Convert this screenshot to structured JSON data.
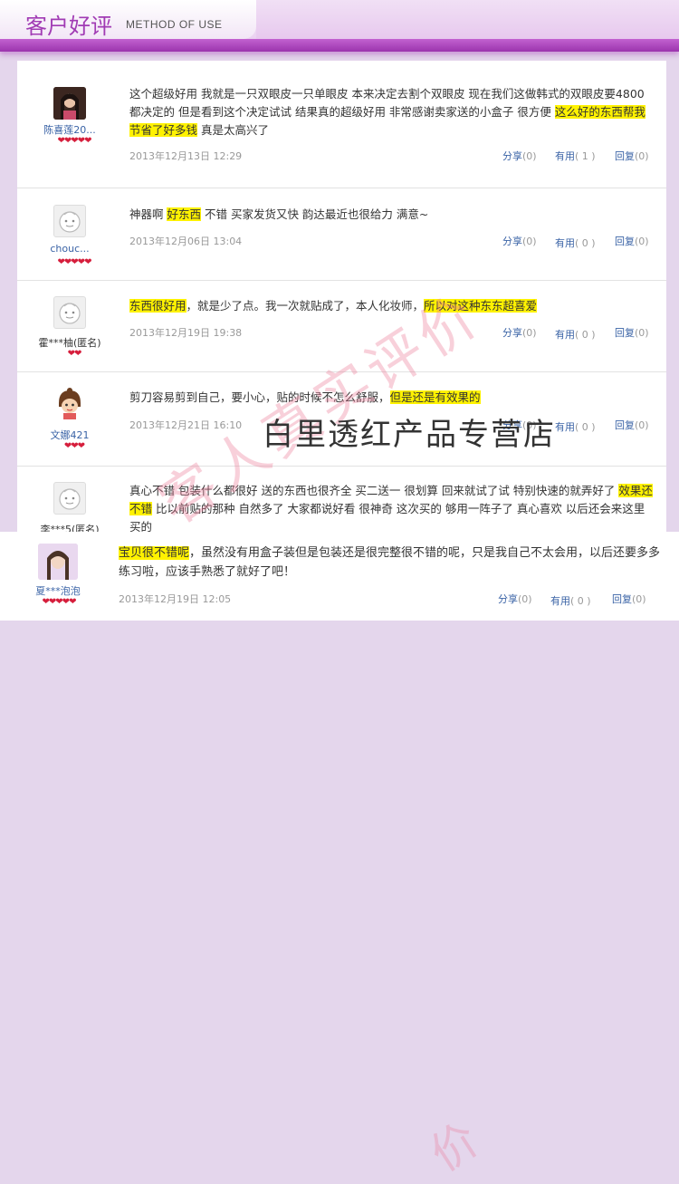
{
  "header": {
    "title": "客户好评",
    "subtitle": "METHOD OF USE"
  },
  "watermark": {
    "text": "客人真实评价",
    "shop": "白里透红产品专营店",
    "partial": "价"
  },
  "colors": {
    "accent": "#a13bb4",
    "highlight": "#fff200",
    "link": "#3a63a6",
    "heart": "#d61e3c"
  },
  "reviews": [
    {
      "user": "陈喜莲20...",
      "hearts": "❤❤❤❤❤",
      "text_1": "这个超级好用 我就是一只双眼皮一只单眼皮 本来决定去割个双眼皮 现在我们这做韩式的双眼皮要4800 都决定的 但是看到这个决定试试 结果真的超级好用 非常感谢卖家送的小盒子 很方便 ",
      "hl_1": "这么好的东西帮我节省了好多钱",
      "text_2": " 真是太高兴了",
      "date": "2013年12月13日 12:29",
      "share": "分享",
      "share_count": "(0)",
      "useful": "有用",
      "useful_count": "( 1 )",
      "reply": "回复",
      "reply_count": "(0)"
    },
    {
      "user": "chouc...",
      "hearts": "❤❤❤❤❤",
      "text_1": "神器啊 ",
      "hl_1": "好东西",
      "text_2": " 不错 买家发货又快 韵达最近也很给力 满意~",
      "date": "2013年12月06日 13:04",
      "share": "分享",
      "share_count": "(0)",
      "useful": "有用",
      "useful_count": "( 0 )",
      "reply": "回复",
      "reply_count": "(0)"
    },
    {
      "user": "霍***柚(匿名)",
      "hearts": "❤❤",
      "hl_1": "东西很好用",
      "text_1": "，就是少了点。我一次就贴成了，本人化妆师，",
      "hl_2": "所以对这种东东超喜爱",
      "date": "2013年12月19日 19:38",
      "share": "分享",
      "share_count": "(0)",
      "useful": "有用",
      "useful_count": "( 0 )",
      "reply": "回复",
      "reply_count": "(0)"
    },
    {
      "user": "文娜421",
      "hearts": "❤❤❤",
      "text_1": "剪刀容易剪到自己，要小心，贴的时候不怎么舒服，",
      "hl_1": "但是还是有效果的",
      "date": "2013年12月21日 16:10",
      "share": "分享",
      "share_count": "(0)",
      "useful": "有用",
      "useful_count": "( 0 )",
      "reply": "回复",
      "reply_count": "(0)"
    },
    {
      "user": "李***5(匿名)",
      "text_1": "真心不错 包装什么都很好 送的东西也很齐全 买二送一 很划算 回来就试了试 特别快速的就弄好了 ",
      "hl_1": "效果还不错",
      "text_2": " 比以前贴的那种 自然多了 大家都说好看 很神奇 这次买的 够用一阵子了 真心喜欢 以后还会来这里买的"
    },
    {
      "user": "夏***泡泡",
      "hearts": "❤❤❤❤❤",
      "hl_1": "宝贝很不错呢",
      "text_1": "，虽然没有用盒子装但是包装还是很完整很不错的呢，只是我自己不太会用，以后还要多多练习啦，应该手熟悉了就好了吧！",
      "date": "2013年12月19日 12:05",
      "share": "分享",
      "share_count": "(0)",
      "useful": "有用",
      "useful_count": "( 0 )",
      "reply": "回复",
      "reply_count": "(0)"
    }
  ]
}
